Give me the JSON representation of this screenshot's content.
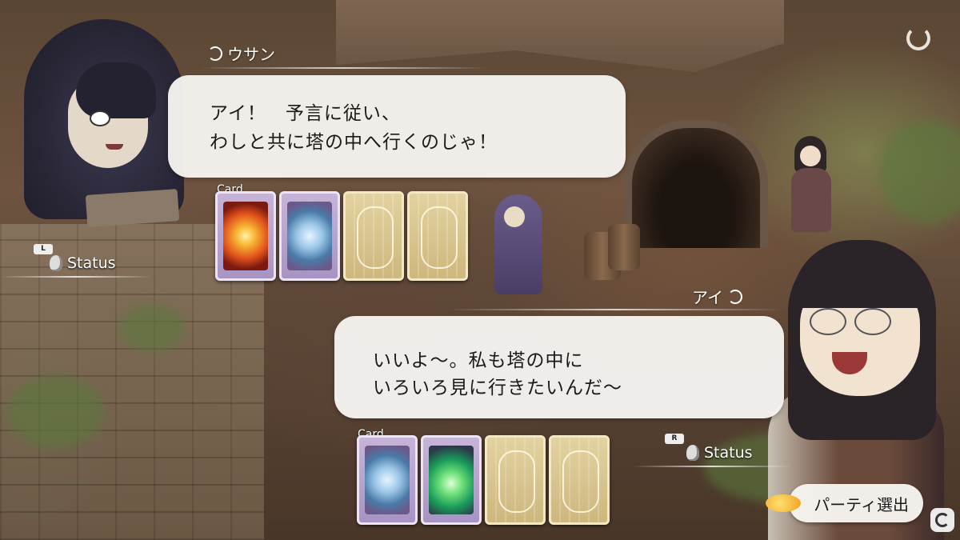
{
  "speaker1": {
    "name": "ウサン",
    "lines": [
      "アイ！　予言に従い、",
      "わしと共に塔の中へ行くのじゃ！"
    ],
    "cards_label": "Card",
    "cards": [
      {
        "kind": "face",
        "art": "fire-card-icon"
      },
      {
        "kind": "face",
        "art": "water-card-icon"
      },
      {
        "kind": "back"
      },
      {
        "kind": "back"
      }
    ],
    "status": {
      "button": "L",
      "label": "Status"
    }
  },
  "speaker2": {
    "name": "アイ",
    "lines": [
      "いいよ～。私も塔の中に",
      "いろいろ見に行きたいんだ～"
    ],
    "cards_label": "Card",
    "cards": [
      {
        "kind": "face",
        "art": "water-card-icon"
      },
      {
        "kind": "face",
        "art": "leaf-card-icon"
      },
      {
        "kind": "back"
      },
      {
        "kind": "back"
      }
    ],
    "status": {
      "button": "R",
      "label": "Status"
    }
  },
  "party_button": "パーティ選出",
  "icons": {
    "back": "undo-arrow-icon",
    "party": "goldfish-icon",
    "watermark": "site-logo-icon"
  },
  "colors": {
    "bubble": "#f6f4f0",
    "text": "#1a1a1a",
    "card_face": "#a894c4",
    "card_back": "#cdb77d"
  }
}
